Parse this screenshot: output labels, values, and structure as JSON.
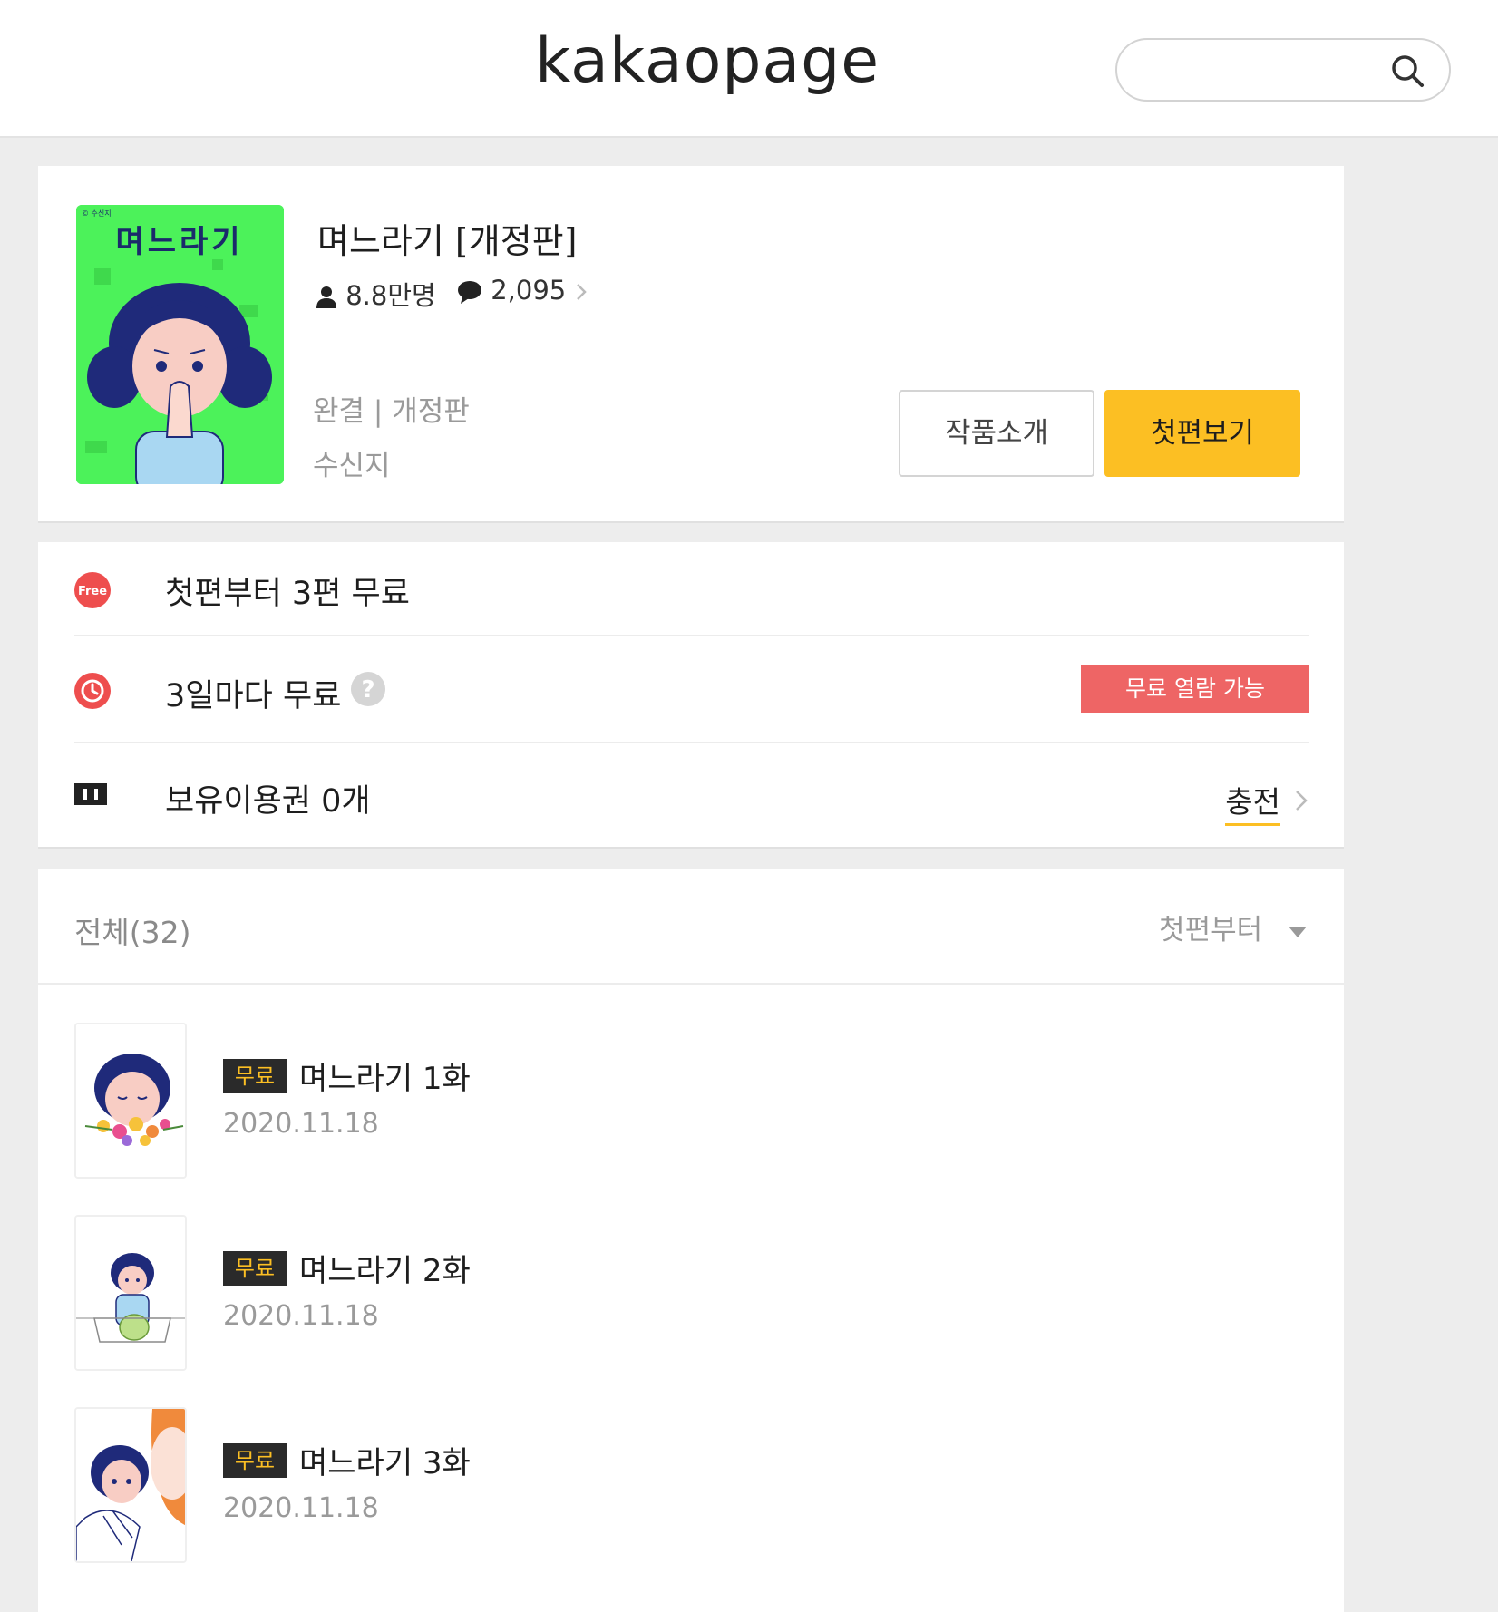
{
  "header": {
    "logo": "kakaopage",
    "search_placeholder": ""
  },
  "work": {
    "title": "며느라기 [개정판]",
    "readers": "8.8만명",
    "comments": "2,095",
    "status": "완결 | 개정판",
    "author": "수신지",
    "intro_button": "작품소개",
    "first_button": "첫편보기",
    "cover_title": "며느라기",
    "cover_author": "© 수신지"
  },
  "info": {
    "free_badge": "Free",
    "free_label": "첫편부터 3편 무료",
    "wait_label": "3일마다 무료",
    "free_open": "무료 열람 가능",
    "ticket_label": "보유이용권 0개",
    "charge": "충전"
  },
  "list": {
    "total": "전체(32)",
    "sort": "첫편부터",
    "episodes": [
      {
        "badge": "무료",
        "title": "며느라기 1화",
        "date": "2020.11.18"
      },
      {
        "badge": "무료",
        "title": "며느라기 2화",
        "date": "2020.11.18"
      },
      {
        "badge": "무료",
        "title": "며느라기 3화",
        "date": "2020.11.18"
      }
    ]
  },
  "colors": {
    "accent_yellow": "#fcbf23",
    "free_red": "#ee6565",
    "cover_green": "#4cf25a"
  }
}
